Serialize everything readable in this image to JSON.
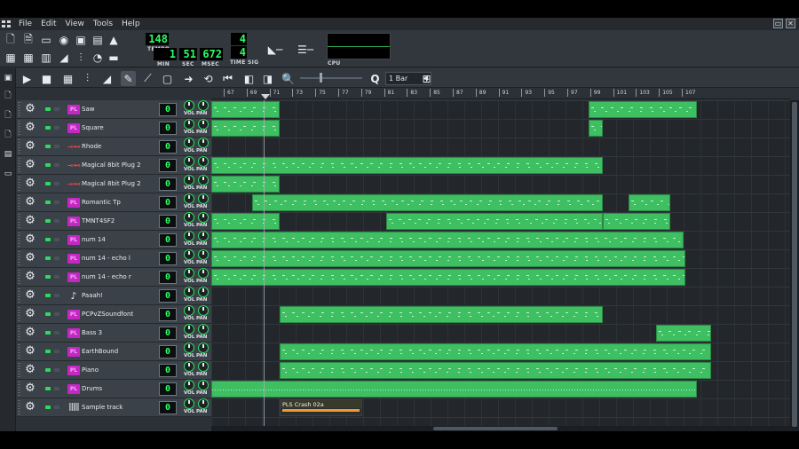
{
  "menu": {
    "items": [
      "File",
      "Edit",
      "View",
      "Tools",
      "Help"
    ],
    "mnemonics": [
      "F",
      "E",
      "V",
      "T",
      "H"
    ]
  },
  "window_controls": {
    "restore": "▭",
    "close": "✕"
  },
  "toolbar": {
    "tempo_value": "148",
    "tempo_label": "TEMPO",
    "time_min": "1",
    "time_sec": "51",
    "time_msec": "672",
    "time_min_label": "MIN",
    "time_sec_label": "SEC",
    "time_msec_label": "MSEC",
    "timesig_num": "4",
    "timesig_den": "4",
    "timesig_label": "TIME SIG",
    "cpu_label": "CPU"
  },
  "edit_toolbar": {
    "quantize_value": "1 Bar",
    "quantize_icon": "Q"
  },
  "ruler": {
    "labels": [
      "67",
      "69",
      "71",
      "73",
      "75",
      "77",
      "79",
      "81",
      "83",
      "85",
      "87",
      "89",
      "91",
      "93",
      "95",
      "97",
      "99",
      "101",
      "103",
      "105",
      "107"
    ]
  },
  "knob_labels": {
    "vol": "VOL",
    "pan": "PAN"
  },
  "tracks": [
    {
      "name": "Saw",
      "activity": "0",
      "icon": "plugin-icon"
    },
    {
      "name": "Square",
      "activity": "0",
      "icon": "plugin-icon"
    },
    {
      "name": "Rhode",
      "activity": "0",
      "icon": "plug-icon"
    },
    {
      "name": "Magical 8bit Plug 2",
      "activity": "0",
      "icon": "plug-icon"
    },
    {
      "name": "Magical 8bit Plug 2",
      "activity": "0",
      "icon": "plug-icon"
    },
    {
      "name": "Romantic Tp",
      "activity": "0",
      "icon": "plugin-icon"
    },
    {
      "name": "TMNT4SF2",
      "activity": "0",
      "icon": "plugin-icon"
    },
    {
      "name": "num 14",
      "activity": "0",
      "icon": "plugin-icon"
    },
    {
      "name": "num 14 - echo l",
      "activity": "0",
      "icon": "plugin-icon"
    },
    {
      "name": "num 14 - echo r",
      "activity": "0",
      "icon": "plugin-icon"
    },
    {
      "name": "Paaah!",
      "activity": "0",
      "icon": "note-icon"
    },
    {
      "name": "PCPvZSoundfont",
      "activity": "0",
      "icon": "plugin-icon"
    },
    {
      "name": "Bass 3",
      "activity": "0",
      "icon": "plugin-icon"
    },
    {
      "name": "EarthBound",
      "activity": "0",
      "icon": "plugin-icon"
    },
    {
      "name": "Piano",
      "activity": "0",
      "icon": "plugin-icon"
    },
    {
      "name": "Drums",
      "activity": "0",
      "icon": "plugin-icon"
    },
    {
      "name": "Sample track",
      "activity": "0",
      "icon": "wave-icon"
    }
  ],
  "sample_clip": {
    "name": "PLS Crash 02a"
  },
  "colors": {
    "clip_green": "#3dbf62",
    "lcd_green": "#2bff64",
    "plugin_magenta": "#c428c4",
    "sample_wave": "#f19a2c"
  }
}
